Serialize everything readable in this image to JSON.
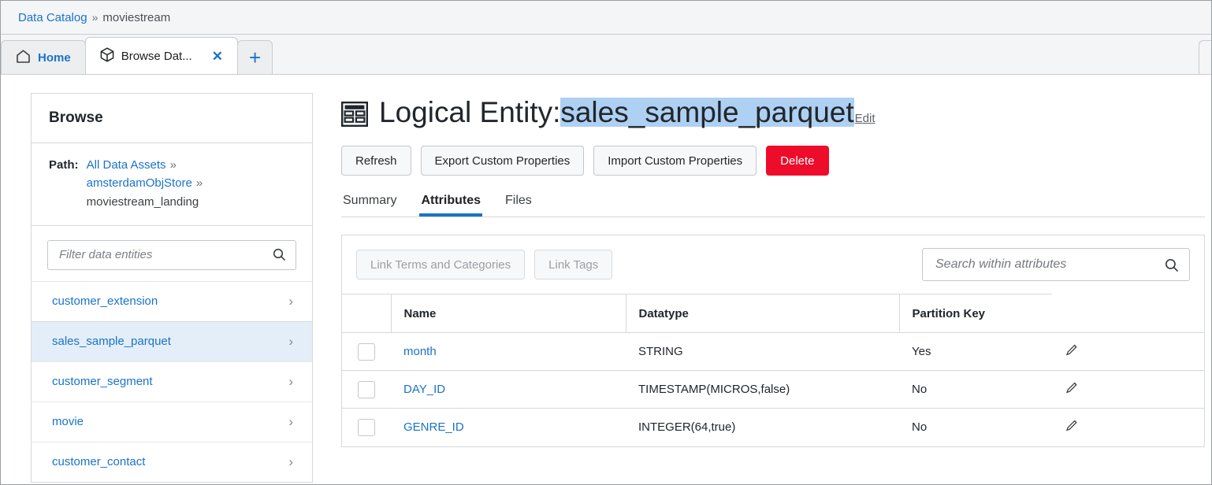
{
  "breadcrumb": {
    "root": "Data Catalog",
    "separator": "»",
    "current": "moviestream"
  },
  "browser_tabs": [
    {
      "label": "Home",
      "icon": "home-icon",
      "active": false
    },
    {
      "label": "Browse Dat...",
      "icon": "cube-icon",
      "active": true,
      "close": "✕"
    }
  ],
  "new_tab_glyph": "+",
  "sidebar": {
    "title": "Browse",
    "path_label": "Path:",
    "path_separator": "»",
    "path_links": [
      "All Data Assets",
      "amsterdamObjStore"
    ],
    "path_leaf": "moviestream_landing",
    "filter_placeholder": "Filter data entities",
    "filter_value": "",
    "search_icon": "search-icon",
    "entities": [
      {
        "name": "customer_extension",
        "selected": false
      },
      {
        "name": "sales_sample_parquet",
        "selected": true
      },
      {
        "name": "customer_segment",
        "selected": false
      },
      {
        "name": "movie",
        "selected": false
      },
      {
        "name": "customer_contact",
        "selected": false
      }
    ],
    "chevron": "›"
  },
  "main": {
    "icon": "table-icon",
    "title_prefix": "Logical Entity:",
    "title_name": "sales_sample_parquet",
    "title_name_highlight_color": "#aed0f2",
    "edit_link": "Edit",
    "actions": [
      {
        "label": "Refresh",
        "style": "default"
      },
      {
        "label": "Export Custom Properties",
        "style": "default"
      },
      {
        "label": "Import Custom Properties",
        "style": "default"
      },
      {
        "label": "Delete",
        "style": "danger",
        "color": "#ee0c2b"
      }
    ],
    "tabs": [
      {
        "label": "Summary",
        "active": false
      },
      {
        "label": "Attributes",
        "active": true
      },
      {
        "label": "Files",
        "active": false
      }
    ],
    "accent_color": "#1a73c8",
    "link_color": "#1a73c8"
  },
  "attributes_panel": {
    "link_buttons": [
      {
        "label": "Link Terms and Categories",
        "disabled": true
      },
      {
        "label": "Link Tags",
        "disabled": true
      }
    ],
    "search_placeholder": "Search within attributes",
    "search_value": "",
    "search_icon": "search-icon",
    "columns": [
      "",
      "Name",
      "Datatype",
      "Partition Key",
      ""
    ],
    "rows": [
      {
        "checked": false,
        "name": "month",
        "datatype": "STRING",
        "partition_key": "Yes",
        "edit_icon": "pencil-icon"
      },
      {
        "checked": false,
        "name": "DAY_ID",
        "datatype": "TIMESTAMP(MICROS,false)",
        "partition_key": "No",
        "edit_icon": "pencil-icon"
      },
      {
        "checked": false,
        "name": "GENRE_ID",
        "datatype": "INTEGER(64,true)",
        "partition_key": "No",
        "edit_icon": "pencil-icon"
      }
    ]
  }
}
